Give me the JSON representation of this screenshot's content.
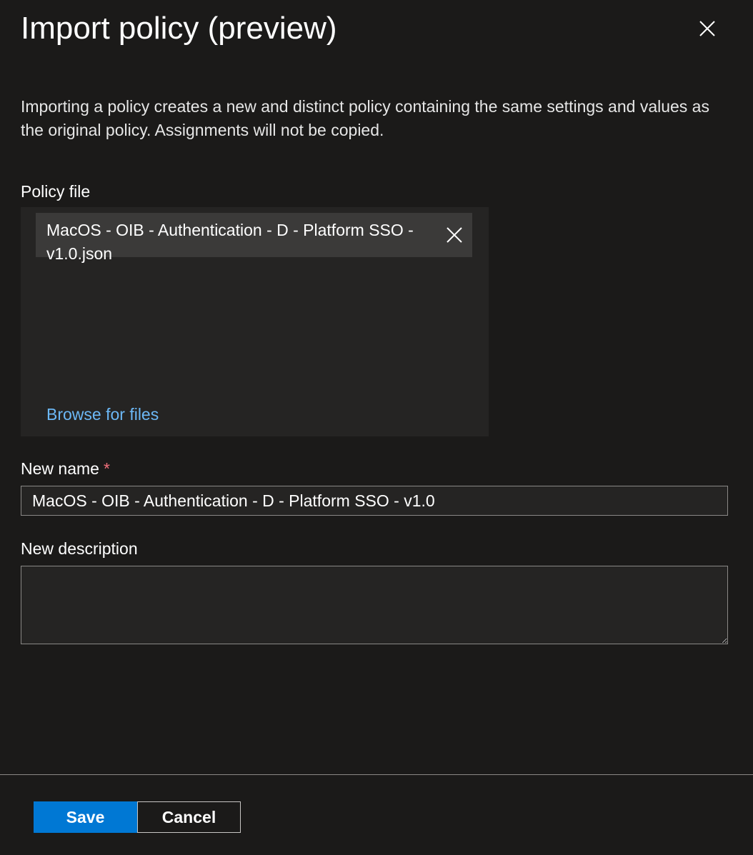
{
  "panel": {
    "title": "Import policy (preview)",
    "close_icon": "close-icon",
    "description": "Importing a policy creates a new and distinct policy containing the same settings and values as the original policy. Assignments will not be copied."
  },
  "policy_file": {
    "label": "Policy file",
    "selected_file": "MacOS - OIB - Authentication - D - Platform SSO - v1.0.json",
    "remove_icon": "close-icon",
    "browse_label": "Browse for files"
  },
  "new_name": {
    "label": "New name",
    "required_marker": "*",
    "value": "MacOS - OIB - Authentication - D - Platform SSO - v1.0"
  },
  "new_description": {
    "label": "New description",
    "value": ""
  },
  "footer": {
    "save_label": "Save",
    "cancel_label": "Cancel"
  },
  "colors": {
    "background": "#1b1a19",
    "field_background": "#252423",
    "chip_background": "#3b3a39",
    "primary": "#0078d4",
    "link": "#6cb8f6",
    "required": "#f1707b"
  }
}
